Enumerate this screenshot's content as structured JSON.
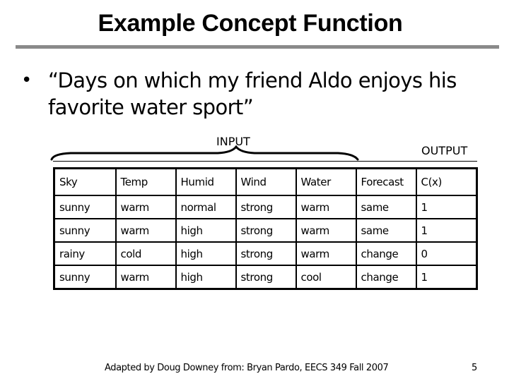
{
  "slide": {
    "title": "Example Concept Function",
    "bullet": {
      "marker": "•",
      "text": "“Days on which my friend Aldo enjoys his favorite water sport”"
    },
    "input_label": "INPUT",
    "output_label": "OUTPUT",
    "footer": "Adapted by Doug Downey from: Bryan Pardo, EECS 349 Fall 2007",
    "page_number": "5"
  },
  "table": {
    "headers": [
      "Sky",
      "Temp",
      "Humid",
      "Wind",
      "Water",
      "Forecast",
      "C(x)"
    ],
    "rows": [
      [
        "sunny",
        "warm",
        "normal",
        "strong",
        "warm",
        "same",
        "1"
      ],
      [
        "sunny",
        "warm",
        "high",
        "strong",
        "warm",
        "same",
        "1"
      ],
      [
        "rainy",
        "cold",
        "high",
        "strong",
        "warm",
        "change",
        "0"
      ],
      [
        "sunny",
        "warm",
        "high",
        "strong",
        "cool",
        "change",
        "1"
      ]
    ]
  }
}
